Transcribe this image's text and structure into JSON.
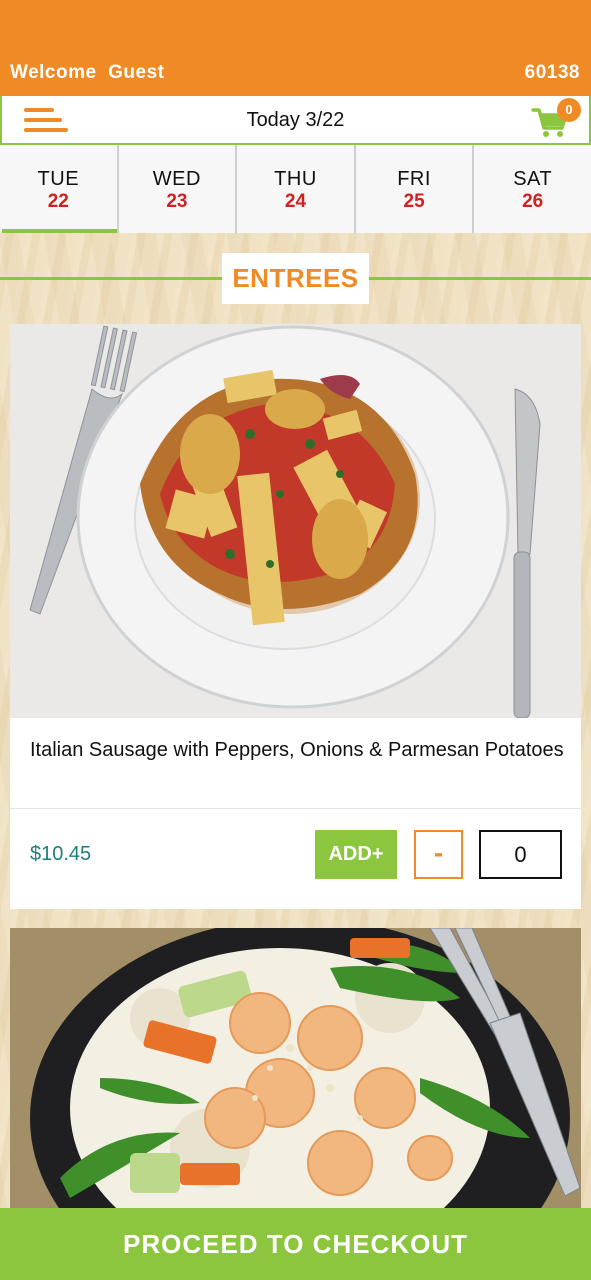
{
  "header": {
    "welcome": "Welcome  Guest",
    "zip": "60138",
    "date_label": "Today 3/22",
    "cart_count": "0",
    "menu_icon": "hamburger-menu-icon",
    "cart_icon": "shopping-cart-icon"
  },
  "days": [
    {
      "name": "TUE",
      "num": "22",
      "active": true
    },
    {
      "name": "WED",
      "num": "23",
      "active": false
    },
    {
      "name": "THU",
      "num": "24",
      "active": false
    },
    {
      "name": "FRI",
      "num": "25",
      "active": false
    },
    {
      "name": "SAT",
      "num": "26",
      "active": false
    }
  ],
  "section": {
    "title": "ENTREES"
  },
  "items": [
    {
      "name": "Italian Sausage with Peppers, Onions & Parmesan Potatoes",
      "price": "$10.45",
      "add_label": "ADD+",
      "minus_label": "-",
      "quantity": "0"
    }
  ],
  "checkout": {
    "label": "PROCEED TO CHECKOUT"
  },
  "colors": {
    "brand_orange": "#f08a24",
    "brand_green": "#8cc63f",
    "price_teal": "#1d7f7b",
    "date_red": "#d21f1f"
  }
}
